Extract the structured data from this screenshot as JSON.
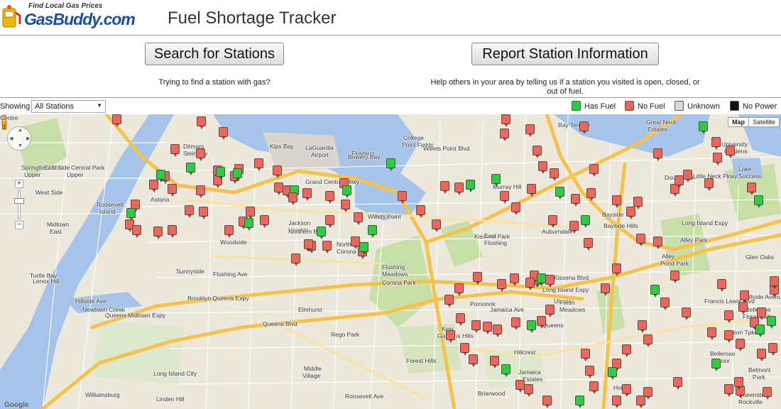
{
  "header": {
    "logo_tagline": "Find Local Gas Prices",
    "logo_name_part1": "Gas",
    "logo_name_part2": "Buddy.com",
    "title": "Fuel Shortage Tracker"
  },
  "actions": {
    "search_label": "Search for Stations",
    "search_caption": "Trying to find a station with gas?",
    "report_label": "Report Station Information",
    "report_caption": "Help others in your area by telling us if a station you visited is open, closed, or out of fuel."
  },
  "filter": {
    "showing_label": "Showing",
    "selected": "All Stations"
  },
  "legend": [
    {
      "label": "Has Fuel",
      "color": "#2ecc40"
    },
    {
      "label": "No Fuel",
      "color": "#f0655a"
    },
    {
      "label": "Unknown",
      "color": "#d9d9d9"
    },
    {
      "label": "No Power",
      "color": "#111111"
    }
  ],
  "map": {
    "type_active": "Map",
    "type_inactive": "Satellite",
    "attribution": "Google",
    "labels": [
      {
        "text": "Ditmars"
      },
      {
        "text": "Steinway"
      },
      {
        "text": "LaGuardia"
      },
      {
        "text": "Airport"
      },
      {
        "text": "Flushing"
      },
      {
        "text": "Bay"
      },
      {
        "text": "College"
      },
      {
        "text": "Point Fields"
      },
      {
        "text": "Willets Point Blvd"
      },
      {
        "text": "Bay Terrace"
      },
      {
        "text": "Great Neck"
      },
      {
        "text": "Estates"
      },
      {
        "text": "University"
      },
      {
        "text": "Gardens"
      },
      {
        "text": "Lake"
      },
      {
        "text": "Success"
      },
      {
        "text": "Douglaston"
      },
      {
        "text": "Little Neck Pkwy"
      },
      {
        "text": "Bayside"
      },
      {
        "text": "Bayside Hills"
      },
      {
        "text": "Alley Park"
      },
      {
        "text": "Alley"
      },
      {
        "text": "Pond Park"
      },
      {
        "text": "Glen Oaks"
      },
      {
        "text": "Long Island Expy"
      },
      {
        "text": "Hillside Avenue"
      },
      {
        "text": "Bellerose"
      },
      {
        "text": "Floral Park"
      },
      {
        "text": "Belmont"
      },
      {
        "text": "Park"
      },
      {
        "text": "Roosevelt"
      },
      {
        "text": "Island"
      },
      {
        "text": "Astoria"
      },
      {
        "text": "Midtown"
      },
      {
        "text": "East"
      },
      {
        "text": "Woodside"
      },
      {
        "text": "Jackson"
      },
      {
        "text": "Heights"
      },
      {
        "text": "North"
      },
      {
        "text": "Corona"
      },
      {
        "text": "Flushing"
      },
      {
        "text": "Meadows"
      },
      {
        "text": "Corona Park"
      },
      {
        "text": "Willets Point"
      },
      {
        "text": "Murray Hill"
      },
      {
        "text": "Kissena Park"
      },
      {
        "text": "Auburndale"
      },
      {
        "text": "East"
      },
      {
        "text": "Flushing"
      },
      {
        "text": "Sunnyside"
      },
      {
        "text": "Elmhurst"
      },
      {
        "text": "Pomonok"
      },
      {
        "text": "Utopia"
      },
      {
        "text": "Fresh"
      },
      {
        "text": "Meadows"
      },
      {
        "text": "Kew"
      },
      {
        "text": "Gardens Hills"
      },
      {
        "text": "Queens"
      },
      {
        "text": "Hillcrest"
      },
      {
        "text": "Rego Park"
      },
      {
        "text": "Middle"
      },
      {
        "text": "Village"
      },
      {
        "text": "Forest Hills"
      },
      {
        "text": "Jamaica"
      },
      {
        "text": "Estates"
      },
      {
        "text": "Briarwood"
      },
      {
        "text": "Hollis"
      },
      {
        "text": "Bellerose"
      },
      {
        "text": "Manor"
      },
      {
        "text": "Grand Central Pkwy"
      },
      {
        "text": "Brooklyn Queens Expy"
      },
      {
        "text": "Queens Midtown Expy"
      },
      {
        "text": "Long Island Expy"
      },
      {
        "text": "Northern Blvd"
      },
      {
        "text": "Queens Blvd"
      },
      {
        "text": "Union Tpke"
      },
      {
        "text": "Hillside Ave"
      },
      {
        "text": "Newtown Creek"
      },
      {
        "text": "Long Island City"
      },
      {
        "text": "Linden Hill"
      },
      {
        "text": "Flushing Ave"
      },
      {
        "text": "Roosevelt Ave"
      },
      {
        "text": "Jamaica Ave"
      },
      {
        "text": "Kissena Blvd"
      },
      {
        "text": "Francis Lewis Blvd"
      },
      {
        "text": "Springfield Blvd"
      },
      {
        "text": "Central Park"
      },
      {
        "text": "Upper"
      },
      {
        "text": "East Side"
      },
      {
        "text": "Upper"
      },
      {
        "text": "West Side"
      },
      {
        "text": "Lenox Hill"
      },
      {
        "text": "Turtle Bay"
      },
      {
        "text": "Kips Bay"
      },
      {
        "text": "Bowery Bay"
      },
      {
        "text": "Flushing Bay"
      },
      {
        "text": "Williamsburg"
      },
      {
        "text": "Queensboro"
      },
      {
        "text": "Rockville"
      },
      {
        "text": "Centre"
      }
    ],
    "markers": [
      {
        "status": "no"
      },
      {
        "status": "no"
      },
      {
        "status": "no"
      },
      {
        "status": "no"
      },
      {
        "status": "no"
      },
      {
        "status": "has"
      },
      {
        "status": "no"
      },
      {
        "status": "no"
      },
      {
        "status": "no"
      },
      {
        "status": "no"
      },
      {
        "status": "no"
      },
      {
        "status": "no"
      },
      {
        "status": "no"
      },
      {
        "status": "no"
      },
      {
        "status": "has"
      },
      {
        "status": "no"
      },
      {
        "status": "no"
      },
      {
        "status": "has"
      },
      {
        "status": "has"
      },
      {
        "status": "no"
      },
      {
        "status": "has"
      },
      {
        "status": "no"
      },
      {
        "status": "no"
      },
      {
        "status": "no"
      },
      {
        "status": "no"
      },
      {
        "status": "no"
      },
      {
        "status": "no"
      },
      {
        "status": "no"
      },
      {
        "status": "no"
      },
      {
        "status": "has"
      },
      {
        "status": "no"
      },
      {
        "status": "no"
      },
      {
        "status": "no"
      },
      {
        "status": "no"
      },
      {
        "status": "has"
      },
      {
        "status": "no"
      },
      {
        "status": "no"
      },
      {
        "status": "no"
      },
      {
        "status": "no"
      },
      {
        "status": "no"
      },
      {
        "status": "has"
      },
      {
        "status": "no"
      },
      {
        "status": "no"
      },
      {
        "status": "has"
      },
      {
        "status": "has"
      },
      {
        "status": "no"
      },
      {
        "status": "no"
      },
      {
        "status": "no"
      },
      {
        "status": "no"
      },
      {
        "status": "no"
      },
      {
        "status": "no"
      },
      {
        "status": "has"
      },
      {
        "status": "has"
      },
      {
        "status": "no"
      },
      {
        "status": "no"
      },
      {
        "status": "no"
      },
      {
        "status": "no"
      },
      {
        "status": "no"
      },
      {
        "status": "has"
      },
      {
        "status": "has"
      },
      {
        "status": "no"
      },
      {
        "status": "no"
      },
      {
        "status": "no"
      },
      {
        "status": "no"
      },
      {
        "status": "no"
      },
      {
        "status": "no"
      },
      {
        "status": "has"
      },
      {
        "status": "no"
      },
      {
        "status": "no"
      },
      {
        "status": "no"
      },
      {
        "status": "no"
      },
      {
        "status": "no"
      },
      {
        "status": "no"
      },
      {
        "status": "no"
      },
      {
        "status": "no"
      },
      {
        "status": "no"
      },
      {
        "status": "has"
      },
      {
        "status": "no"
      },
      {
        "status": "no"
      },
      {
        "status": "no"
      },
      {
        "status": "no"
      },
      {
        "status": "has"
      },
      {
        "status": "no"
      },
      {
        "status": "no"
      },
      {
        "status": "no"
      },
      {
        "status": "no"
      },
      {
        "status": "no"
      },
      {
        "status": "no"
      },
      {
        "status": "no"
      },
      {
        "status": "has"
      },
      {
        "status": "no"
      },
      {
        "status": "no"
      },
      {
        "status": "no"
      },
      {
        "status": "no"
      },
      {
        "status": "no"
      },
      {
        "status": "has"
      },
      {
        "status": "no"
      },
      {
        "status": "no"
      },
      {
        "status": "no"
      },
      {
        "status": "no"
      },
      {
        "status": "no"
      },
      {
        "status": "no"
      },
      {
        "status": "no"
      },
      {
        "status": "no"
      },
      {
        "status": "no"
      },
      {
        "status": "no"
      },
      {
        "status": "has"
      },
      {
        "status": "has"
      },
      {
        "status": "no"
      },
      {
        "status": "no"
      },
      {
        "status": "no"
      },
      {
        "status": "no"
      },
      {
        "status": "no"
      },
      {
        "status": "no"
      },
      {
        "status": "no"
      },
      {
        "status": "no"
      },
      {
        "status": "no"
      },
      {
        "status": "no"
      },
      {
        "status": "has"
      },
      {
        "status": "no"
      },
      {
        "status": "no"
      },
      {
        "status": "no"
      },
      {
        "status": "no"
      },
      {
        "status": "no"
      },
      {
        "status": "no"
      },
      {
        "status": "no"
      },
      {
        "status": "has"
      },
      {
        "status": "no"
      },
      {
        "status": "no"
      },
      {
        "status": "no"
      },
      {
        "status": "no"
      },
      {
        "status": "no"
      },
      {
        "status": "no"
      },
      {
        "status": "has"
      },
      {
        "status": "no"
      },
      {
        "status": "no"
      },
      {
        "status": "no"
      },
      {
        "status": "has"
      },
      {
        "status": "no"
      },
      {
        "status": "no"
      },
      {
        "status": "no"
      },
      {
        "status": "no"
      },
      {
        "status": "no"
      },
      {
        "status": "no"
      },
      {
        "status": "no"
      },
      {
        "status": "no"
      },
      {
        "status": "no"
      },
      {
        "status": "has"
      },
      {
        "status": "no"
      },
      {
        "status": "no"
      },
      {
        "status": "no"
      },
      {
        "status": "no"
      },
      {
        "status": "no"
      },
      {
        "status": "has"
      },
      {
        "status": "no"
      },
      {
        "status": "no"
      },
      {
        "status": "no"
      },
      {
        "status": "no"
      },
      {
        "status": "no"
      },
      {
        "status": "no"
      }
    ]
  }
}
